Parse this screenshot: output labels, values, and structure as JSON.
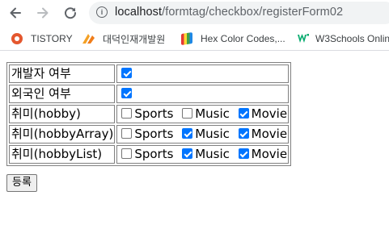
{
  "browser": {
    "url_host": "localhost",
    "url_path": "/formtag/checkbox/registerForm02"
  },
  "bookmarks": [
    {
      "label": "TISTORY",
      "icon": "tistory-icon"
    },
    {
      "label": "대덕인재개발원",
      "icon": "daedeok-icon"
    },
    {
      "label": "Hex Color Codes,...",
      "icon": "hex-color-icon"
    },
    {
      "label": "W3Schools Onlin",
      "icon": "w3schools-icon"
    }
  ],
  "form": {
    "rows": [
      {
        "label": "개발자 여부",
        "checked": true
      },
      {
        "label": "외국인 여부",
        "checked": true
      }
    ],
    "hobby_rows": [
      {
        "label": "취미(hobby)",
        "options": [
          {
            "label": "Sports",
            "checked": false
          },
          {
            "label": "Music",
            "checked": false
          },
          {
            "label": "Movie",
            "checked": true
          }
        ]
      },
      {
        "label": "취미(hobbyArray)",
        "options": [
          {
            "label": "Sports",
            "checked": false
          },
          {
            "label": "Music",
            "checked": true
          },
          {
            "label": "Movie",
            "checked": true
          }
        ]
      },
      {
        "label": "취미(hobbyList)",
        "options": [
          {
            "label": "Sports",
            "checked": false
          },
          {
            "label": "Music",
            "checked": true
          },
          {
            "label": "Movie",
            "checked": true
          }
        ]
      }
    ],
    "submit_label": "등록"
  },
  "colors": {
    "checkbox_accent": "#0075ff",
    "addressbar_bg": "#f1f3f4"
  }
}
